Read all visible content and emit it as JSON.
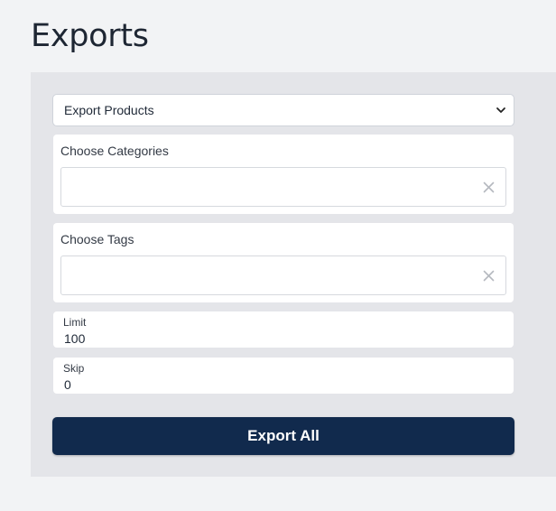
{
  "page": {
    "title": "Exports"
  },
  "export_type": {
    "selected": "Export Products"
  },
  "categories": {
    "label": "Choose Categories",
    "value": ""
  },
  "tags": {
    "label": "Choose Tags",
    "value": ""
  },
  "limit": {
    "label": "Limit",
    "value": "100"
  },
  "skip": {
    "label": "Skip",
    "value": "0"
  },
  "actions": {
    "export_all_label": "Export All"
  },
  "icons": {
    "dropdown": "chevron-down-icon",
    "clear": "close-icon"
  },
  "colors": {
    "primary_button": "#112a4d",
    "panel_background": "#e4e5e9",
    "page_background": "#f2f3f5"
  }
}
